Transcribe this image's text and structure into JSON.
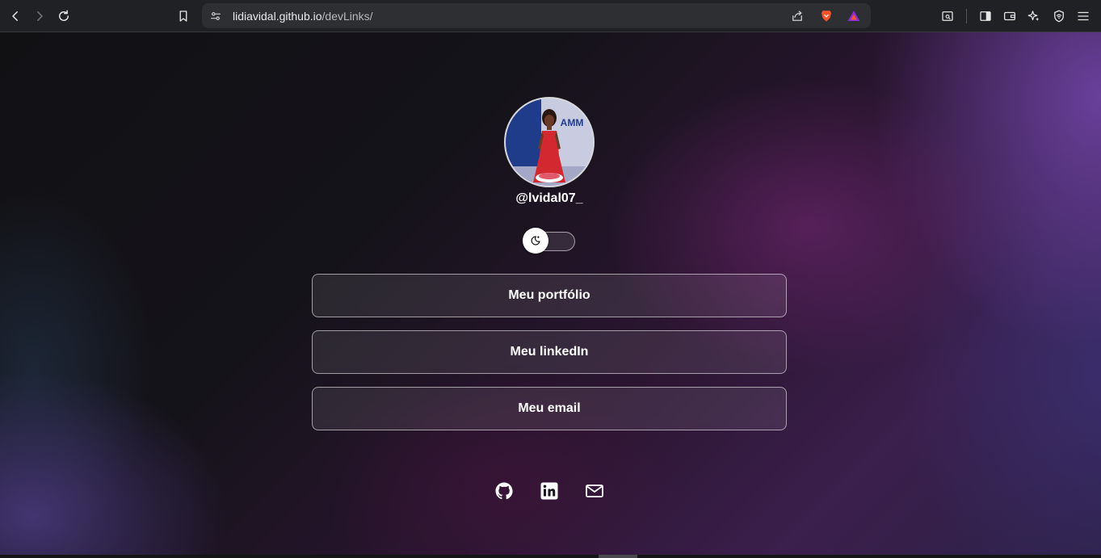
{
  "browser": {
    "url_host": "lidiavidal.github.io",
    "url_path": "/devLinks/",
    "icons": {
      "back": "chevron-left-icon",
      "forward": "chevron-right-icon",
      "reload": "reload-icon",
      "bookmark": "bookmark-icon",
      "site_info": "site-settings-icon",
      "share": "share-icon",
      "brave_shields": "brave-lion-icon",
      "brave_rewards": "brave-rewards-icon",
      "reader_mode": "reader-icon",
      "sidebar": "sidebar-icon",
      "wallet": "wallet-icon",
      "leo": "leo-ai-icon",
      "vpn": "vpn-icon",
      "menu": "hamburger-menu-icon"
    },
    "colors": {
      "brave_orange": "#fb542b",
      "rewards_purple": "#8b2bd9"
    }
  },
  "profile": {
    "username": "@lvidal07_",
    "avatar_icon": "profile-photo"
  },
  "theme_switch": {
    "icon": "moon-icon",
    "state": "off"
  },
  "links": [
    {
      "label": "Meu portfólio"
    },
    {
      "label": "Meu linkedIn"
    },
    {
      "label": "Meu email"
    }
  ],
  "social": {
    "github": "github-icon",
    "linkedin": "linkedin-icon",
    "email": "mail-icon"
  },
  "colors": {
    "text": "#ffffff",
    "button_border": "rgba(255,255,255,0.55)",
    "button_bg": "rgba(255,255,255,0.09)"
  }
}
